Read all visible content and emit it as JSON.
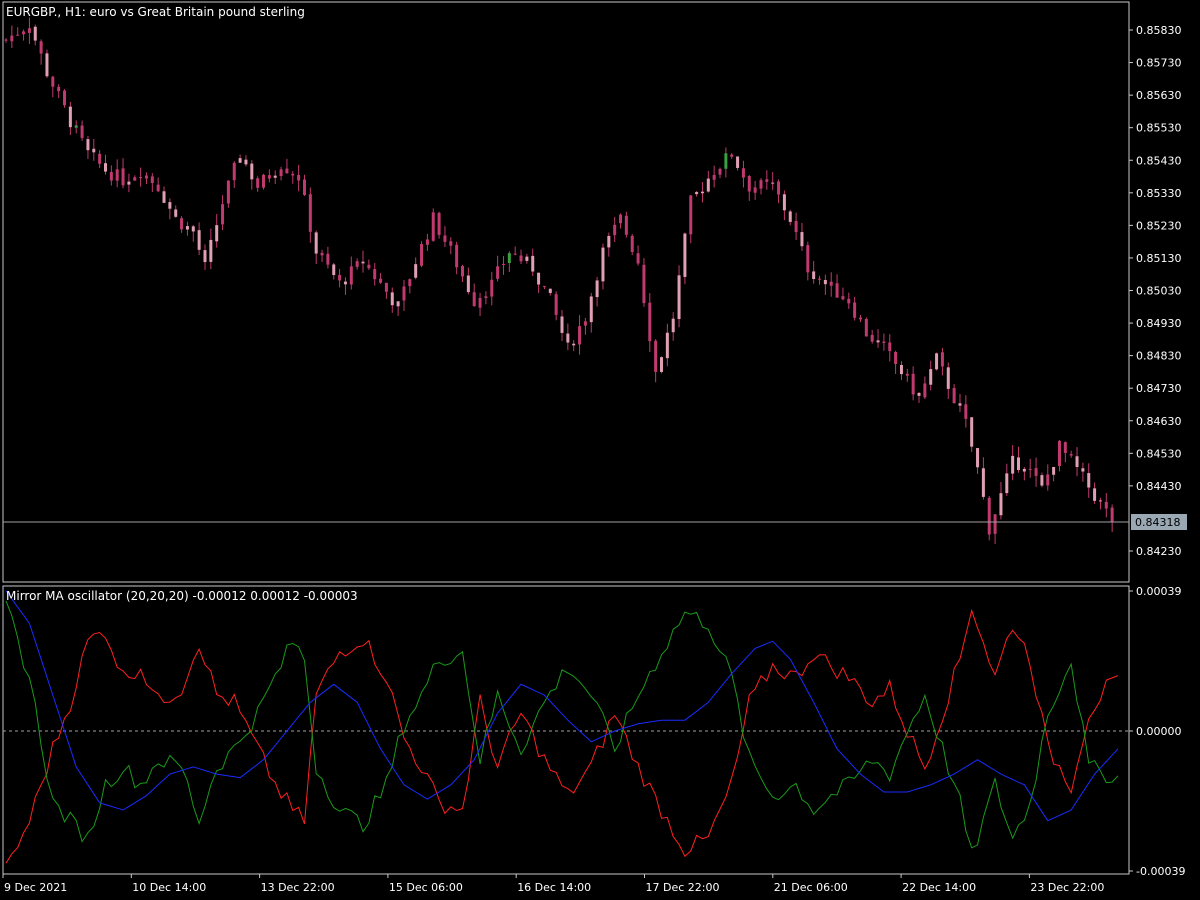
{
  "window": {
    "symbol_title": "EURGBP., H1:  euro vs Great Britain pound sterling",
    "indicator_title": "Mirror MA oscillator (20,20,20) -0.00012 0.00012 -0.00003"
  },
  "colors": {
    "background": "#000000",
    "frame": "#c8c8c8",
    "candle": "#e0a0b4",
    "candle_dark": "#c03a70",
    "candle_up": "#3aa040",
    "price_line": "#a0a0a0",
    "price_badge": "#9aa8b4",
    "series_red": "#ff2020",
    "series_green": "#1a9a1a",
    "series_blue": "#1a2cff",
    "zero_line": "#a0a0a0"
  },
  "price_axis": {
    "ticks": [
      "0.85830",
      "0.85730",
      "0.85630",
      "0.85530",
      "0.85430",
      "0.85330",
      "0.85230",
      "0.85130",
      "0.85030",
      "0.84930",
      "0.84830",
      "0.84730",
      "0.84630",
      "0.84530",
      "0.84430",
      "0.84230"
    ],
    "current_price": "0.84318"
  },
  "osc_axis": {
    "ticks": [
      "0.00039",
      "0.00000",
      "-0.00039"
    ]
  },
  "time_axis": {
    "labels": [
      "9 Dec 2021",
      "10 Dec 14:00",
      "13 Dec 22:00",
      "15 Dec 06:00",
      "16 Dec 14:00",
      "17 Dec 22:00",
      "21 Dec 06:00",
      "22 Dec 14:00",
      "23 Dec 22:00"
    ]
  },
  "chart_data": [
    {
      "type": "candlestick",
      "title": "EURGBP., H1:  euro vs Great Britain pound sterling",
      "ylim": [
        0.8418,
        0.859
      ],
      "current_price": 0.84318,
      "close_path": [
        [
          0,
          0.858
        ],
        [
          4,
          0.8585
        ],
        [
          7,
          0.857
        ],
        [
          11,
          0.8555
        ],
        [
          14,
          0.8545
        ],
        [
          17,
          0.854
        ],
        [
          20,
          0.8537
        ],
        [
          23,
          0.854
        ],
        [
          26,
          0.8535
        ],
        [
          29,
          0.8525
        ],
        [
          32,
          0.8521
        ],
        [
          34,
          0.851
        ],
        [
          37,
          0.853
        ],
        [
          40,
          0.8545
        ],
        [
          43,
          0.8535
        ],
        [
          47,
          0.8542
        ],
        [
          50,
          0.8538
        ],
        [
          53,
          0.8515
        ],
        [
          57,
          0.8505
        ],
        [
          61,
          0.8512
        ],
        [
          64,
          0.8505
        ],
        [
          67,
          0.8498
        ],
        [
          70,
          0.8512
        ],
        [
          73,
          0.8525
        ],
        [
          76,
          0.8515
        ],
        [
          80,
          0.85
        ],
        [
          83,
          0.8505
        ],
        [
          86,
          0.8515
        ],
        [
          90,
          0.851
        ],
        [
          93,
          0.85
        ],
        [
          96,
          0.8485
        ],
        [
          99,
          0.8495
        ],
        [
          102,
          0.8515
        ],
        [
          105,
          0.8525
        ],
        [
          108,
          0.8512
        ],
        [
          111,
          0.8478
        ],
        [
          114,
          0.8495
        ],
        [
          117,
          0.853
        ],
        [
          121,
          0.854
        ],
        [
          124,
          0.8545
        ],
        [
          127,
          0.8535
        ],
        [
          131,
          0.8535
        ],
        [
          134,
          0.8525
        ],
        [
          137,
          0.851
        ],
        [
          140,
          0.8505
        ],
        [
          144,
          0.85
        ],
        [
          147,
          0.849
        ],
        [
          150,
          0.8485
        ],
        [
          153,
          0.8478
        ],
        [
          156,
          0.847
        ],
        [
          159,
          0.8482
        ],
        [
          162,
          0.847
        ],
        [
          164,
          0.8462
        ],
        [
          166,
          0.8448
        ],
        [
          168,
          0.843
        ],
        [
          170,
          0.844
        ],
        [
          172,
          0.845
        ],
        [
          174,
          0.845
        ],
        [
          177,
          0.8442
        ],
        [
          180,
          0.8455
        ],
        [
          183,
          0.8448
        ],
        [
          186,
          0.844
        ],
        [
          190,
          0.843
        ]
      ]
    },
    {
      "type": "line",
      "title": "Mirror MA oscillator (20,20,20) -0.00012 0.00012 -0.00003",
      "ylim": [
        -0.00039,
        0.00039
      ],
      "series": [
        {
          "color": "#ff2020",
          "points": [
            [
              0,
              -0.00039
            ],
            [
              4,
              -0.00025
            ],
            [
              8,
              -5e-05
            ],
            [
              11,
              8e-05
            ],
            [
              14,
              0.00025
            ],
            [
              17,
              0.00028
            ],
            [
              20,
              0.00015
            ],
            [
              23,
              0.00018
            ],
            [
              26,
              8e-05
            ],
            [
              30,
              0.00012
            ],
            [
              33,
              0.00025
            ],
            [
              36,
              0.0001
            ],
            [
              39,
              8e-05
            ],
            [
              43,
              -5e-05
            ],
            [
              46,
              -0.00015
            ],
            [
              49,
              -0.00022
            ],
            [
              51,
              -0.00025
            ],
            [
              53,
              0.0001
            ],
            [
              57,
              0.00022
            ],
            [
              61,
              0.00026
            ],
            [
              65,
              0.00015
            ],
            [
              68,
              -2e-05
            ],
            [
              71,
              -0.0001
            ],
            [
              74,
              -0.0002
            ],
            [
              78,
              -0.00022
            ],
            [
              81,
              8e-05
            ],
            [
              84,
              -0.0001
            ],
            [
              88,
              5e-05
            ],
            [
              92,
              -8e-05
            ],
            [
              96,
              -0.00018
            ],
            [
              100,
              -0.0001
            ],
            [
              104,
              5e-05
            ],
            [
              108,
              -0.0001
            ],
            [
              112,
              -0.00022
            ],
            [
              116,
              -0.00033
            ],
            [
              120,
              -0.0003
            ],
            [
              124,
              -0.00015
            ],
            [
              127,
              8e-05
            ],
            [
              131,
              0.00018
            ],
            [
              135,
              0.00015
            ],
            [
              138,
              0.00022
            ],
            [
              141,
              0.00018
            ],
            [
              144,
              0.00015
            ],
            [
              148,
              8e-05
            ],
            [
              151,
              0.00012
            ],
            [
              154,
              0.0
            ],
            [
              157,
              -0.0001
            ],
            [
              160,
              5e-05
            ],
            [
              163,
              0.0002
            ],
            [
              165,
              0.00035
            ],
            [
              167,
              0.00025
            ],
            [
              169,
              0.00015
            ],
            [
              172,
              0.0003
            ],
            [
              175,
              0.0002
            ],
            [
              178,
              -5e-05
            ],
            [
              182,
              -0.00015
            ],
            [
              185,
              5e-05
            ],
            [
              188,
              0.00012
            ],
            [
              190,
              0.00013
            ]
          ]
        },
        {
          "color": "#1a9a1a",
          "points": [
            [
              0,
              0.00035
            ],
            [
              4,
              0.00015
            ],
            [
              8,
              -0.0002
            ],
            [
              11,
              -0.00025
            ],
            [
              14,
              -0.0003
            ],
            [
              17,
              -0.00015
            ],
            [
              20,
              -0.0001
            ],
            [
              23,
              -0.00015
            ],
            [
              26,
              -8e-05
            ],
            [
              30,
              -0.0001
            ],
            [
              33,
              -0.00025
            ],
            [
              36,
              -0.0001
            ],
            [
              39,
              -5e-05
            ],
            [
              43,
              5e-05
            ],
            [
              46,
              0.00015
            ],
            [
              49,
              0.00025
            ],
            [
              51,
              0.0002
            ],
            [
              53,
              -0.0001
            ],
            [
              57,
              -0.00022
            ],
            [
              61,
              -0.00026
            ],
            [
              65,
              -0.00015
            ],
            [
              68,
              2e-05
            ],
            [
              71,
              0.0001
            ],
            [
              74,
              0.0002
            ],
            [
              78,
              0.00022
            ],
            [
              81,
              -8e-05
            ],
            [
              84,
              0.0001
            ],
            [
              88,
              -5e-05
            ],
            [
              92,
              8e-05
            ],
            [
              96,
              0.00018
            ],
            [
              100,
              0.0001
            ],
            [
              104,
              -5e-05
            ],
            [
              108,
              0.0001
            ],
            [
              112,
              0.00022
            ],
            [
              116,
              0.00033
            ],
            [
              120,
              0.0003
            ],
            [
              124,
              0.00015
            ],
            [
              127,
              -8e-05
            ],
            [
              131,
              -0.00018
            ],
            [
              135,
              -0.00015
            ],
            [
              138,
              -0.00022
            ],
            [
              141,
              -0.00018
            ],
            [
              144,
              -0.00015
            ],
            [
              148,
              -8e-05
            ],
            [
              151,
              -0.00012
            ],
            [
              154,
              0.0
            ],
            [
              157,
              0.0001
            ],
            [
              160,
              -5e-05
            ],
            [
              163,
              -0.0002
            ],
            [
              165,
              -0.00035
            ],
            [
              167,
              -0.00025
            ],
            [
              169,
              -0.00015
            ],
            [
              172,
              -0.0003
            ],
            [
              175,
              -0.0002
            ],
            [
              178,
              5e-05
            ],
            [
              182,
              0.0002
            ],
            [
              185,
              -0.0001
            ],
            [
              188,
              -0.00012
            ],
            [
              190,
              -0.00013
            ]
          ]
        },
        {
          "color": "#1a2cff",
          "points": [
            [
              0,
              0.00039
            ],
            [
              4,
              0.0003
            ],
            [
              8,
              0.0001
            ],
            [
              12,
              -0.0001
            ],
            [
              16,
              -0.0002
            ],
            [
              20,
              -0.00022
            ],
            [
              24,
              -0.00018
            ],
            [
              28,
              -0.00012
            ],
            [
              32,
              -0.0001
            ],
            [
              36,
              -0.00012
            ],
            [
              40,
              -0.00013
            ],
            [
              44,
              -8e-05
            ],
            [
              48,
              0.0
            ],
            [
              52,
              8e-05
            ],
            [
              56,
              0.00013
            ],
            [
              60,
              8e-05
            ],
            [
              64,
              -5e-05
            ],
            [
              68,
              -0.00015
            ],
            [
              72,
              -0.00019
            ],
            [
              76,
              -0.00015
            ],
            [
              80,
              -8e-05
            ],
            [
              84,
              5e-05
            ],
            [
              88,
              0.00013
            ],
            [
              92,
              0.0001
            ],
            [
              96,
              3e-05
            ],
            [
              100,
              -3e-05
            ],
            [
              104,
              0.0
            ],
            [
              108,
              2e-05
            ],
            [
              112,
              3e-05
            ],
            [
              116,
              3e-05
            ],
            [
              120,
              8e-05
            ],
            [
              124,
              0.00016
            ],
            [
              128,
              0.00023
            ],
            [
              131,
              0.00025
            ],
            [
              134,
              0.0002
            ],
            [
              138,
              8e-05
            ],
            [
              142,
              -5e-05
            ],
            [
              146,
              -0.00012
            ],
            [
              150,
              -0.00017
            ],
            [
              154,
              -0.00017
            ],
            [
              158,
              -0.00015
            ],
            [
              162,
              -0.00012
            ],
            [
              166,
              -8e-05
            ],
            [
              170,
              -0.00012
            ],
            [
              174,
              -0.00015
            ],
            [
              178,
              -0.00025
            ],
            [
              182,
              -0.00022
            ],
            [
              186,
              -0.00012
            ],
            [
              190,
              -5e-05
            ]
          ]
        }
      ]
    }
  ]
}
